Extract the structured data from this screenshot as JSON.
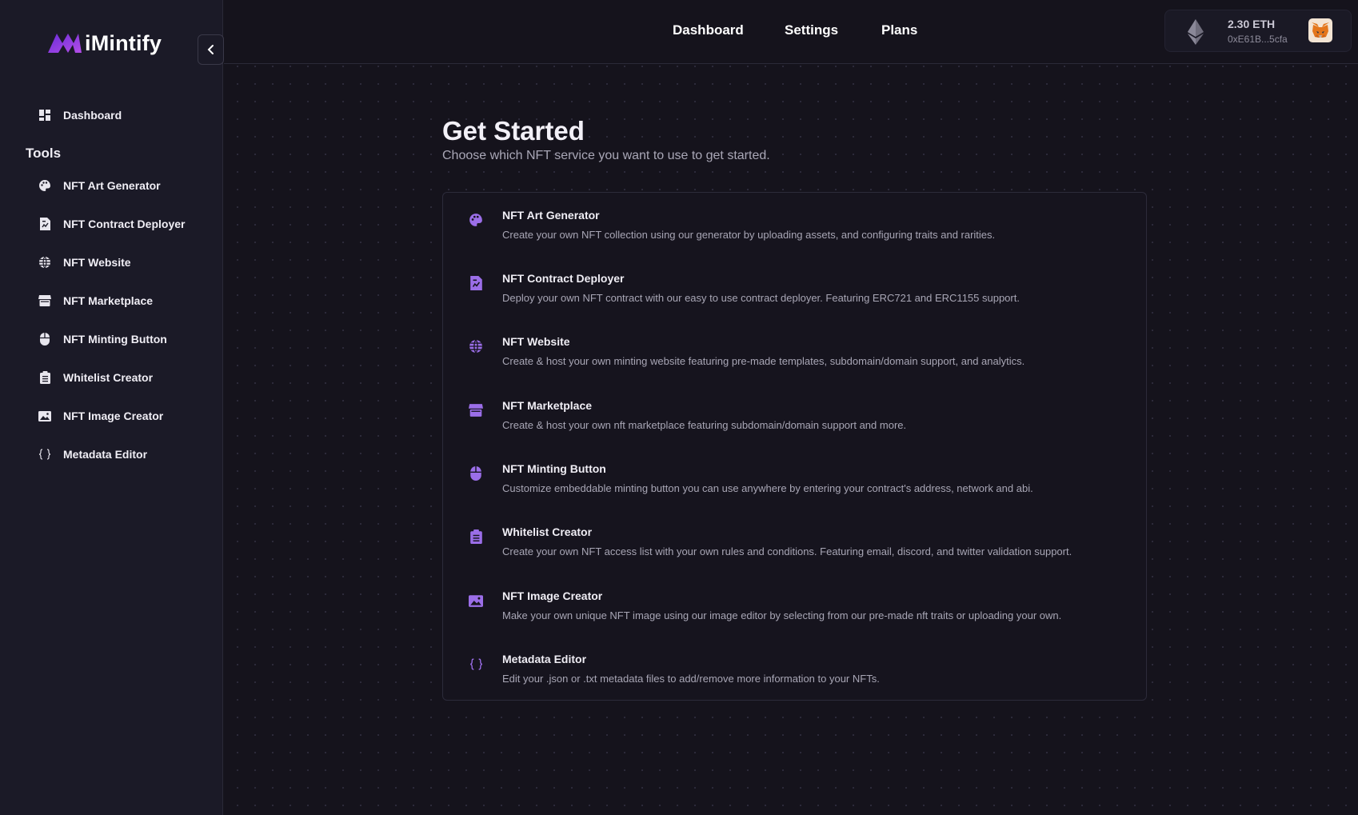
{
  "brand": {
    "name": "iMintify"
  },
  "colors": {
    "accent": "#9b6ee8",
    "background": "#15131c",
    "sidebar": "#1b1a27"
  },
  "sidebar": {
    "dashboard_label": "Dashboard",
    "tools_heading": "Tools",
    "items": [
      {
        "label": "NFT Art Generator",
        "icon": "palette-icon"
      },
      {
        "label": "NFT Contract Deployer",
        "icon": "document-icon"
      },
      {
        "label": "NFT Website",
        "icon": "globe-icon"
      },
      {
        "label": "NFT Marketplace",
        "icon": "store-icon"
      },
      {
        "label": "NFT Minting Button",
        "icon": "mouse-icon"
      },
      {
        "label": "Whitelist Creator",
        "icon": "clipboard-icon"
      },
      {
        "label": "NFT Image Creator",
        "icon": "image-icon"
      },
      {
        "label": "Metadata Editor",
        "icon": "braces-icon"
      }
    ]
  },
  "topnav": {
    "items": [
      {
        "label": "Dashboard"
      },
      {
        "label": "Settings"
      },
      {
        "label": "Plans"
      }
    ]
  },
  "wallet": {
    "balance": "2.30 ETH",
    "address": "0xE61B...5cfa"
  },
  "main": {
    "title": "Get Started",
    "subtitle": "Choose which NFT service you want to use to get started.",
    "services": [
      {
        "name": "NFT Art Generator",
        "description": "Create your own NFT collection using our generator by uploading assets, and configuring traits and rarities.",
        "icon": "palette-icon"
      },
      {
        "name": "NFT Contract Deployer",
        "description": "Deploy your own NFT contract with our easy to use contract deployer. Featuring ERC721 and ERC1155 support.",
        "icon": "document-icon"
      },
      {
        "name": "NFT Website",
        "description": "Create & host your own minting website featuring pre-made templates, subdomain/domain support, and analytics.",
        "icon": "globe-icon"
      },
      {
        "name": "NFT Marketplace",
        "description": "Create & host your own nft marketplace featuring subdomain/domain support and more.",
        "icon": "store-icon"
      },
      {
        "name": "NFT Minting Button",
        "description": "Customize embeddable minting button you can use anywhere by entering your contract's address, network and abi.",
        "icon": "mouse-icon"
      },
      {
        "name": "Whitelist Creator",
        "description": "Create your own NFT access list with your own rules and conditions. Featuring email, discord, and twitter validation support.",
        "icon": "clipboard-icon"
      },
      {
        "name": "NFT Image Creator",
        "description": "Make your own unique NFT image using our image editor by selecting from our pre-made nft traits or uploading your own.",
        "icon": "image-icon"
      },
      {
        "name": "Metadata Editor",
        "description": "Edit your .json or .txt metadata files to add/remove more information to your NFTs.",
        "icon": "braces-icon"
      }
    ]
  }
}
